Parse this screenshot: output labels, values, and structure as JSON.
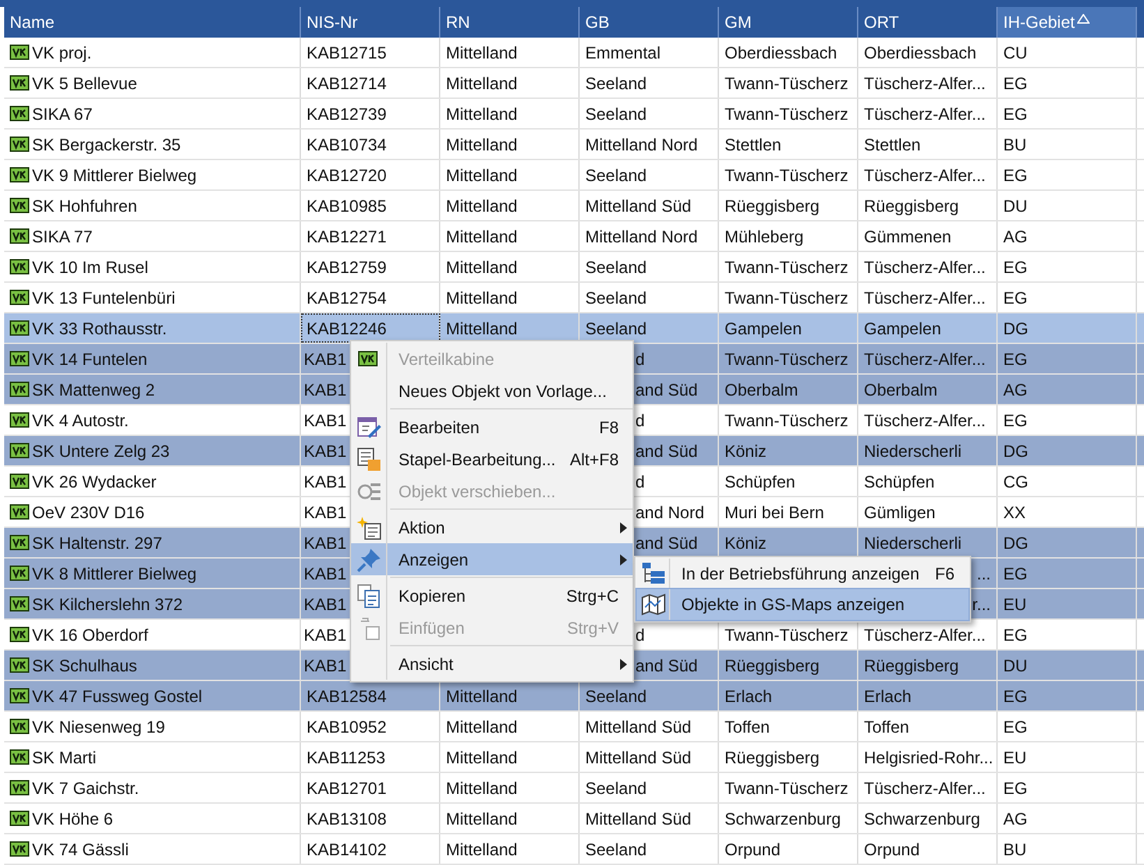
{
  "table": {
    "columns": [
      {
        "label": "Name",
        "sorted": false
      },
      {
        "label": "NIS-Nr",
        "sorted": false
      },
      {
        "label": "RN",
        "sorted": false
      },
      {
        "label": "GB",
        "sorted": false
      },
      {
        "label": "GM",
        "sorted": false
      },
      {
        "label": "ORT",
        "sorted": false
      },
      {
        "label": "IH-Gebiet",
        "sorted": true
      }
    ],
    "rows": [
      {
        "name": "VK proj.",
        "nis": "KAB12715",
        "rn": "Mittelland",
        "gb": "Emmental",
        "gm": "Oberdiessbach",
        "ort": "Oberdiessbach",
        "ih": "CU",
        "selected": false,
        "current": false
      },
      {
        "name": "VK 5 Bellevue",
        "nis": "KAB12714",
        "rn": "Mittelland",
        "gb": "Seeland",
        "gm": "Twann-Tüscherz",
        "ort": "Tüscherz-Alfer...",
        "ih": "EG",
        "selected": false,
        "current": false
      },
      {
        "name": "SIKA 67",
        "nis": "KAB12739",
        "rn": "Mittelland",
        "gb": "Seeland",
        "gm": "Twann-Tüscherz",
        "ort": "Tüscherz-Alfer...",
        "ih": "EG",
        "selected": false,
        "current": false
      },
      {
        "name": "SK Bergackerstr. 35",
        "nis": "KAB10734",
        "rn": "Mittelland",
        "gb": "Mittelland Nord",
        "gm": "Stettlen",
        "ort": "Stettlen",
        "ih": "BU",
        "selected": false,
        "current": false
      },
      {
        "name": "VK 9 Mittlerer Bielweg",
        "nis": "KAB12720",
        "rn": "Mittelland",
        "gb": "Seeland",
        "gm": "Twann-Tüscherz",
        "ort": "Tüscherz-Alfer...",
        "ih": "EG",
        "selected": false,
        "current": false
      },
      {
        "name": "SK Hohfuhren",
        "nis": "KAB10985",
        "rn": "Mittelland",
        "gb": "Mittelland Süd",
        "gm": "Rüeggisberg",
        "ort": "Rüeggisberg",
        "ih": "DU",
        "selected": false,
        "current": false
      },
      {
        "name": "SIKA 77",
        "nis": "KAB12271",
        "rn": "Mittelland",
        "gb": "Mittelland Nord",
        "gm": "Mühleberg",
        "ort": "Gümmenen",
        "ih": "AG",
        "selected": false,
        "current": false
      },
      {
        "name": "VK 10 Im Rusel",
        "nis": "KAB12759",
        "rn": "Mittelland",
        "gb": "Seeland",
        "gm": "Twann-Tüscherz",
        "ort": "Tüscherz-Alfer...",
        "ih": "EG",
        "selected": false,
        "current": false
      },
      {
        "name": "VK 13 Funtelenbüri",
        "nis": "KAB12754",
        "rn": "Mittelland",
        "gb": "Seeland",
        "gm": "Twann-Tüscherz",
        "ort": "Tüscherz-Alfer...",
        "ih": "EG",
        "selected": false,
        "current": false
      },
      {
        "name": "VK 33 Rothausstr.",
        "nis": "KAB12246",
        "rn": "Mittelland",
        "gb": "Seeland",
        "gm": "Gampelen",
        "ort": "Gampelen",
        "ih": "DG",
        "selected": true,
        "current": true
      },
      {
        "name": "VK 14 Funtelen",
        "nis": "KAB1",
        "gb": "d",
        "gm": "Twann-Tüscherz",
        "ort": "Tüscherz-Alfer...",
        "ih": "EG",
        "selected": true,
        "current": false
      },
      {
        "name": "SK Mattenweg 2",
        "nis": "KAB1",
        "gb": "and Süd",
        "gm": "Oberbalm",
        "ort": "Oberbalm",
        "ih": "AG",
        "selected": true,
        "current": false
      },
      {
        "name": "VK 4 Autostr.",
        "nis": "KAB1",
        "gb": "d",
        "gm": "Twann-Tüscherz",
        "ort": "Tüscherz-Alfer...",
        "ih": "EG",
        "selected": false,
        "current": false
      },
      {
        "name": "SK Untere Zelg 23",
        "nis": "KAB1",
        "gb": "and Süd",
        "gm": "Köniz",
        "ort": "Niederscherli",
        "ih": "DG",
        "selected": true,
        "current": false
      },
      {
        "name": "VK 26 Wydacker",
        "nis": "KAB1",
        "gb": "d",
        "gm": "Schüpfen",
        "ort": "Schüpfen",
        "ih": "CG",
        "selected": false,
        "current": false
      },
      {
        "name": "OeV 230V D16",
        "nis": "KAB1",
        "gb": "and Nord",
        "gm": "Muri bei Bern",
        "ort": "Gümligen",
        "ih": "XX",
        "selected": false,
        "current": false
      },
      {
        "name": "SK Haltenstr. 297",
        "nis": "KAB1",
        "gb": "and Süd",
        "gm": "Köniz",
        "ort": "Niederscherli",
        "ih": "DG",
        "selected": true,
        "current": false
      },
      {
        "name": "VK 8 Mittlerer Bielweg",
        "nis": "KAB1",
        "ort": "...",
        "ih": "EG",
        "selected": true,
        "current": false
      },
      {
        "name": "SK Kilcherslehn 372",
        "nis": "KAB1",
        "ort": "r...",
        "ih": "EU",
        "selected": true,
        "current": false
      },
      {
        "name": "VK 16 Oberdorf",
        "nis": "KAB1",
        "gb": "d",
        "gm": "Twann-Tüscherz",
        "ort": "Tüscherz-Alfer...",
        "ih": "EG",
        "selected": false,
        "current": false
      },
      {
        "name": "SK Schulhaus",
        "nis": "KAB1",
        "gb": "and Süd",
        "gm": "Rüeggisberg",
        "ort": "Rüeggisberg",
        "ih": "DU",
        "selected": true,
        "current": false
      },
      {
        "name": "VK 47 Fussweg Gostel",
        "nis": "KAB12584",
        "rn": "Mittelland",
        "gb": "Seeland",
        "gm": "Erlach",
        "ort": "Erlach",
        "ih": "EG",
        "selected": true,
        "current": false
      },
      {
        "name": "VK Niesenweg 19",
        "nis": "KAB10952",
        "rn": "Mittelland",
        "gb": "Mittelland Süd",
        "gm": "Toffen",
        "ort": "Toffen",
        "ih": "EG",
        "selected": false,
        "current": false
      },
      {
        "name": "SK Marti",
        "nis": "KAB11253",
        "rn": "Mittelland",
        "gb": "Mittelland Süd",
        "gm": "Rüeggisberg",
        "ort": "Helgisried-Rohr...",
        "ih": "EU",
        "selected": false,
        "current": false
      },
      {
        "name": "VK 7 Gaichstr.",
        "nis": "KAB12701",
        "rn": "Mittelland",
        "gb": "Seeland",
        "gm": "Twann-Tüscherz",
        "ort": "Tüscherz-Alfer...",
        "ih": "EG",
        "selected": false,
        "current": false
      },
      {
        "name": "VK Höhe 6",
        "nis": "KAB13108",
        "rn": "Mittelland",
        "gb": "Mittelland Süd",
        "gm": "Schwarzenburg",
        "ort": "Schwarzenburg",
        "ih": "AG",
        "selected": false,
        "current": false
      },
      {
        "name": "VK 74 Gässli",
        "nis": "KAB14102",
        "rn": "Mittelland",
        "gb": "Seeland",
        "gm": "Orpund",
        "ort": "Orpund",
        "ih": "BU",
        "selected": false,
        "current": false
      }
    ]
  },
  "context_menu": {
    "items": [
      {
        "kind": "item",
        "label": "Verteilkabine",
        "disabled": true,
        "submenu": false,
        "selected": false
      },
      {
        "kind": "item",
        "label": "Neues Objekt von Vorlage...",
        "disabled": false,
        "submenu": false,
        "selected": false
      },
      {
        "kind": "separator"
      },
      {
        "kind": "item",
        "label": "Bearbeiten",
        "shortcut": "F8",
        "disabled": false,
        "submenu": false,
        "selected": false
      },
      {
        "kind": "item",
        "label": "Stapel-Bearbeitung...",
        "shortcut": "Alt+F8",
        "disabled": false,
        "submenu": false,
        "selected": false
      },
      {
        "kind": "item",
        "label": "Objekt verschieben...",
        "disabled": true,
        "submenu": false,
        "selected": false
      },
      {
        "kind": "separator"
      },
      {
        "kind": "item",
        "label": "Aktion",
        "disabled": false,
        "submenu": true,
        "selected": false
      },
      {
        "kind": "item",
        "label": "Anzeigen",
        "disabled": false,
        "submenu": true,
        "selected": true
      },
      {
        "kind": "separator"
      },
      {
        "kind": "item",
        "label": "Kopieren",
        "shortcut": "Strg+C",
        "disabled": false,
        "submenu": false,
        "selected": false
      },
      {
        "kind": "item",
        "label": "Einfügen",
        "shortcut": "Strg+V",
        "disabled": true,
        "submenu": false,
        "selected": false
      },
      {
        "kind": "separator"
      },
      {
        "kind": "item",
        "label": "Ansicht",
        "disabled": false,
        "submenu": true,
        "selected": false
      }
    ]
  },
  "submenu": {
    "items": [
      {
        "label": "In der Betriebsführung anzeigen",
        "shortcut": "F6",
        "selected": false
      },
      {
        "label": "Objekte in GS-Maps anzeigen",
        "selected": true
      }
    ]
  }
}
